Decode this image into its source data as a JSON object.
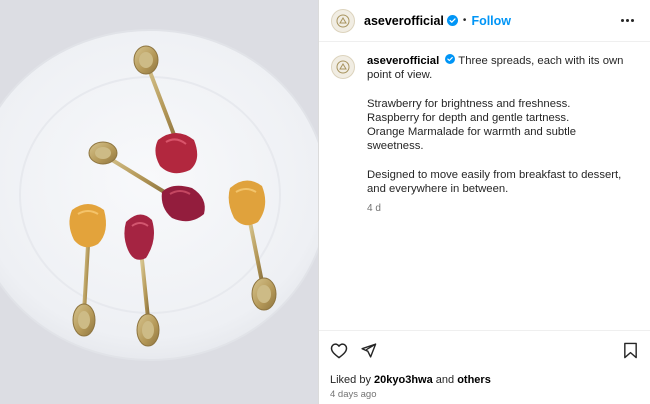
{
  "post": {
    "image_alt": "Three spoons of fruit spreads on a white plate",
    "username": "aseverofficial",
    "follow_label": "Follow",
    "separator": "•",
    "caption": {
      "intro": "Three spreads, each with its own point of view.",
      "lines": [
        "Strawberry for brightness and freshness.",
        "Raspberry for depth and gentle tartness.",
        "Orange Marmalade for warmth and subtle sweetness."
      ],
      "closing": "Designed to move easily from breakfast to dessert, and everywhere in between."
    },
    "caption_age": "4 d",
    "likes": {
      "prefix": "Liked by ",
      "user": "20kyo3hwa",
      "joiner": " and ",
      "others": "others"
    },
    "posted_ago": "4 days ago"
  },
  "icons": {
    "verified": "verified-badge-icon",
    "more": "more-options-icon",
    "like": "heart-icon",
    "share": "share-icon",
    "save": "bookmark-icon",
    "avatar": "brand-logo-icon"
  },
  "colors": {
    "link": "#0095f6",
    "verified": "#0095f6",
    "plate": "#f4f5f8",
    "tablecloth": "#dcdde3",
    "spoon": "#b89e5c",
    "strawberry": "#b2273e",
    "raspberry": "#8f1d3a",
    "marmalade": "#e3a33b"
  }
}
